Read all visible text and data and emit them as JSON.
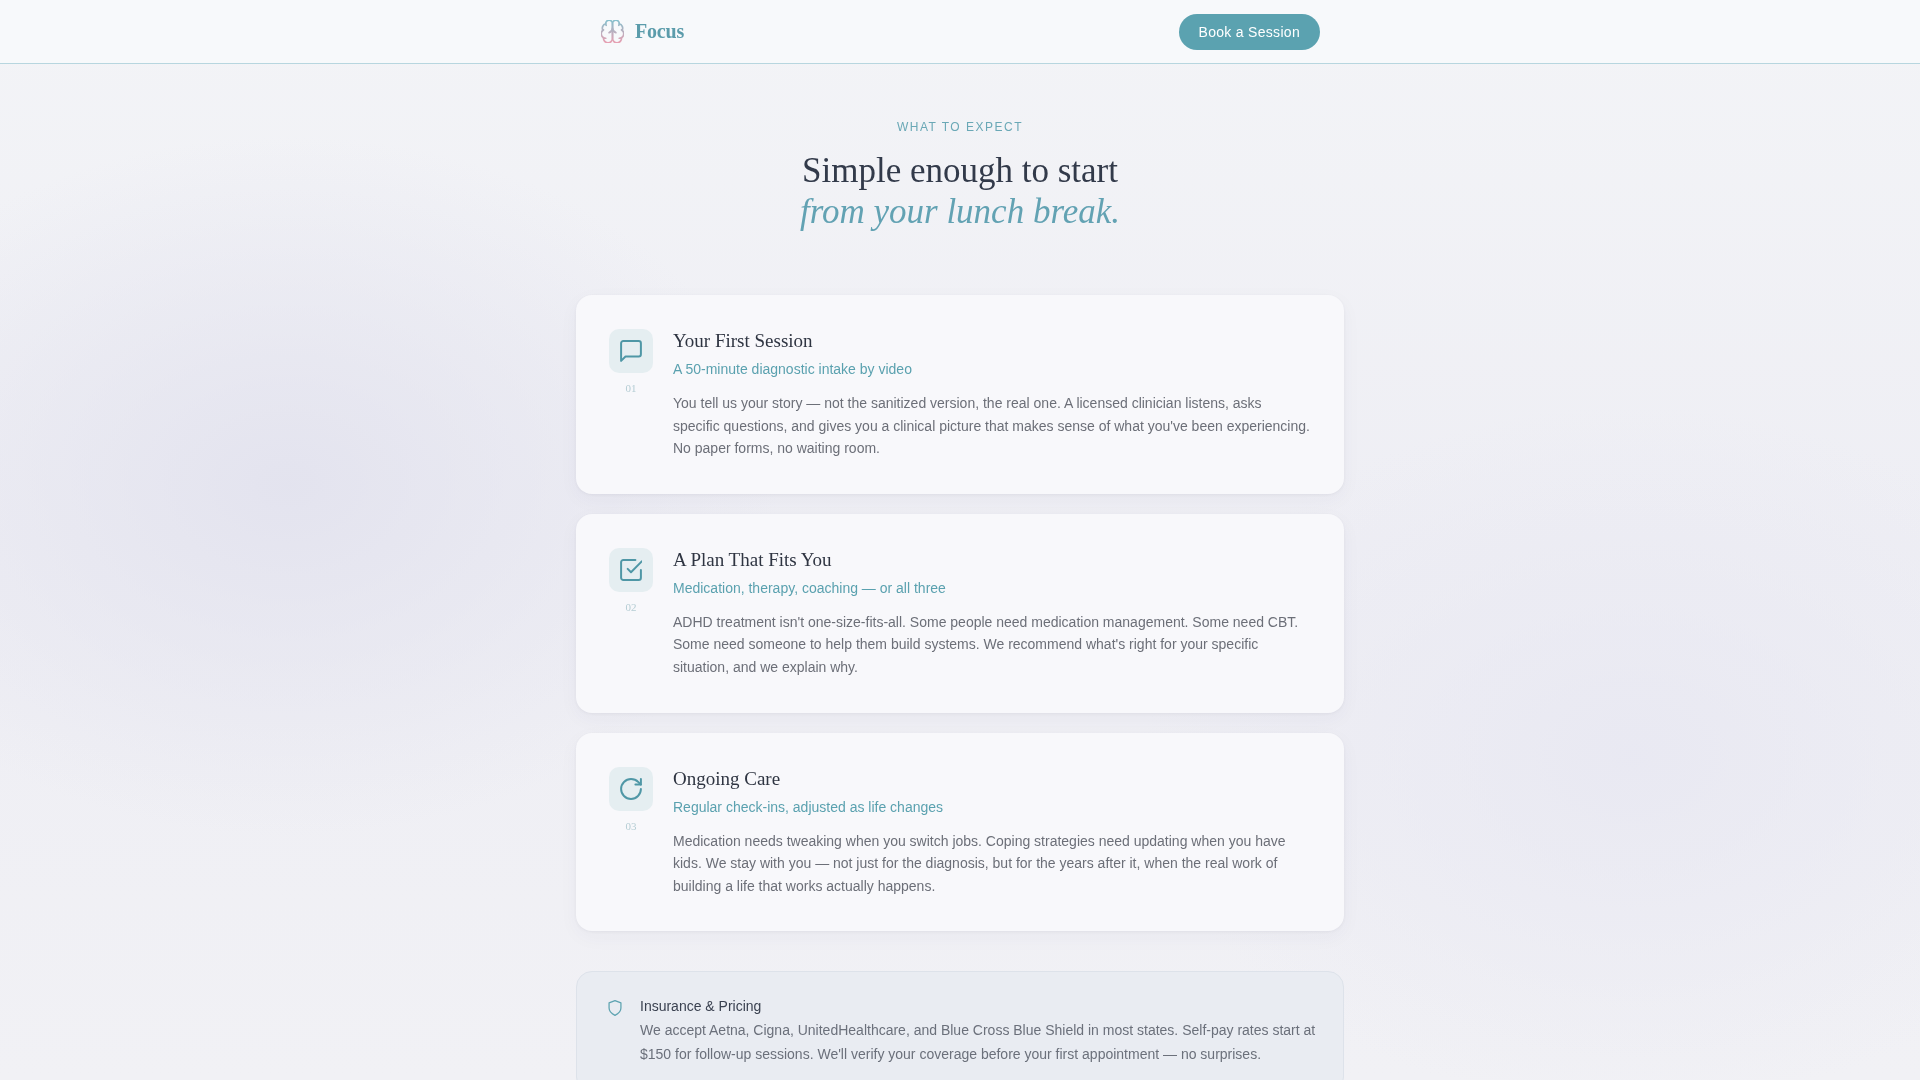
{
  "header": {
    "brand": "Focus",
    "cta": "Book a Session"
  },
  "hero": {
    "eyebrow": "WHAT TO EXPECT",
    "title": "Simple enough to start",
    "title_accent": "from your lunch break."
  },
  "steps": [
    {
      "kind": "intake",
      "number": "01",
      "title": "Your First Session",
      "subtitle": "A 50-minute diagnostic intake by video",
      "body": "You tell us your story — not the sanitized version, the real one. A licensed clinician listens, asks specific questions, and gives you a clinical picture that makes sense of what you've been experiencing. No paper forms, no waiting room."
    },
    {
      "kind": "plan",
      "number": "02",
      "title": "A Plan That Fits You",
      "subtitle": "Medication, therapy, coaching — or all three",
      "body": "ADHD treatment isn't one-size-fits-all. Some people need medication management. Some need CBT. Some need someone to help them build systems. We recommend what's right for your specific situation, and we explain why."
    },
    {
      "kind": "ongoing",
      "number": "03",
      "title": "Ongoing Care",
      "subtitle": "Regular check-ins, adjusted as life changes",
      "body": "Medication needs tweaking when you switch jobs. Coping strategies need updating when you have kids. We stay with you — not just for the diagnosis, but for the years after it, when the real work of building a life that works actually happens."
    }
  ],
  "note": {
    "title": "Insurance & Pricing",
    "body": "We accept Aetna, Cigna, UnitedHealthcare, and Blue Cross Blue Shield in most states. Self-pay rates start at $150 for follow-up sessions. We'll verify your coverage before your first appointment — no surprises."
  }
}
